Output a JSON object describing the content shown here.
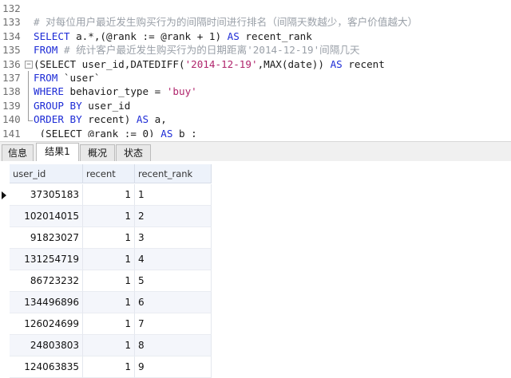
{
  "editor": {
    "lines": [
      {
        "num": "132",
        "parts": []
      },
      {
        "num": "133",
        "parts": [
          {
            "cls": "cm",
            "text": "# 对每位用户最近发生购买行为的间隔时间进行排名（间隔天数越少，客户价值越大）"
          }
        ]
      },
      {
        "num": "134",
        "parts": [
          {
            "cls": "kw",
            "text": "SELECT"
          },
          {
            "cls": "tx",
            "text": " a.*,(@rank := @rank + 1) "
          },
          {
            "cls": "kw",
            "text": "AS"
          },
          {
            "cls": "tx",
            "text": " recent_rank"
          }
        ]
      },
      {
        "num": "135",
        "parts": [
          {
            "cls": "kw",
            "text": "FROM"
          },
          {
            "cls": "tx",
            "text": " "
          },
          {
            "cls": "cm",
            "text": "# 统计客户最近发生购买行为的日期距离'2014-12-19'间隔几天"
          }
        ]
      },
      {
        "num": "136",
        "fold": "open",
        "parts": [
          {
            "cls": "tx",
            "text": "(SELECT user_id,DATEDIFF("
          },
          {
            "cls": "str",
            "text": "'2014-12-19'"
          },
          {
            "cls": "tx",
            "text": ",MAX(date)) "
          },
          {
            "cls": "kw",
            "text": "AS"
          },
          {
            "cls": "tx",
            "text": " recent"
          }
        ]
      },
      {
        "num": "137",
        "fold": "bar",
        "parts": [
          {
            "cls": "kw",
            "text": "FROM"
          },
          {
            "cls": "tx",
            "text": " `user`"
          }
        ]
      },
      {
        "num": "138",
        "fold": "bar",
        "parts": [
          {
            "cls": "kw",
            "text": "WHERE"
          },
          {
            "cls": "tx",
            "text": " behavior_type = "
          },
          {
            "cls": "str",
            "text": "'buy'"
          }
        ]
      },
      {
        "num": "139",
        "fold": "bar",
        "parts": [
          {
            "cls": "kw",
            "text": "GROUP BY"
          },
          {
            "cls": "tx",
            "text": " user_id"
          }
        ]
      },
      {
        "num": "140",
        "fold": "end",
        "parts": [
          {
            "cls": "kw",
            "text": "ORDER BY"
          },
          {
            "cls": "tx",
            "text": " recent) "
          },
          {
            "cls": "kw",
            "text": "AS"
          },
          {
            "cls": "tx",
            "text": " a,"
          }
        ]
      },
      {
        "num": "141",
        "parts": [
          {
            "cls": "tx",
            "text": " (SELECT @rank := 0) "
          },
          {
            "cls": "kw",
            "text": "AS"
          },
          {
            "cls": "tx",
            "text": " b ;"
          }
        ]
      }
    ]
  },
  "tabs": [
    {
      "label": "信息",
      "active": false
    },
    {
      "label": "结果1",
      "active": true
    },
    {
      "label": "概况",
      "active": false
    },
    {
      "label": "状态",
      "active": false
    }
  ],
  "grid": {
    "columns": [
      "user_id",
      "recent",
      "recent_rank"
    ],
    "rows": [
      [
        "37305183",
        "1",
        "1"
      ],
      [
        "102014015",
        "1",
        "2"
      ],
      [
        "91823027",
        "1",
        "3"
      ],
      [
        "131254719",
        "1",
        "4"
      ],
      [
        "86723232",
        "1",
        "5"
      ],
      [
        "134496896",
        "1",
        "6"
      ],
      [
        "126024699",
        "1",
        "7"
      ],
      [
        "24803803",
        "1",
        "8"
      ],
      [
        "124063835",
        "1",
        "9"
      ]
    ]
  }
}
